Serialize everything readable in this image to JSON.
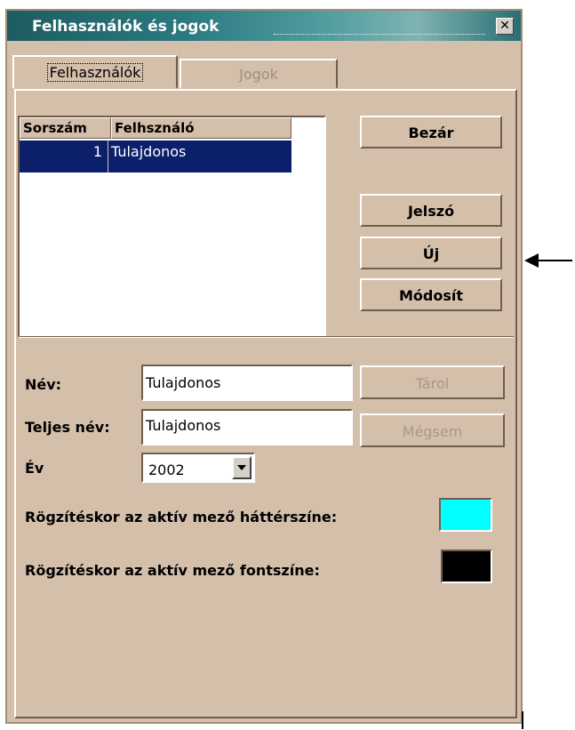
{
  "window": {
    "title": "Felhasználók és jogok",
    "close_glyph": "✕"
  },
  "tabs": [
    {
      "label": "Felhasználók",
      "active": true
    },
    {
      "label": "Jogok",
      "active": false
    }
  ],
  "user_list": {
    "columns": [
      "Sorszám",
      "Felhsználó"
    ],
    "rows": [
      {
        "num": "1",
        "user": "Tulajdonos",
        "selected": true
      }
    ]
  },
  "buttons": {
    "close": "Bezár",
    "password": "Jelszó",
    "new": "Új",
    "modify": "Módosít",
    "save": "Tárol",
    "cancel": "Mégsem"
  },
  "form": {
    "name_label": "Név:",
    "name_value": "Tulajdonos",
    "fullname_label": "Teljes név:",
    "fullname_value": "Tulajdonos",
    "year_label": "Év",
    "year_value": "2002",
    "bg_color_label": "Rögzítéskor az aktív mező háttérszíne:",
    "bg_color_value": "#00ffff",
    "font_color_label": "Rögzítéskor az aktív mező fontszíne:",
    "font_color_value": "#000000"
  },
  "colors": {
    "window_bg": "#d4bfaa",
    "selection_bg": "#0c1f6b",
    "titlebar": "#1d5c61"
  }
}
